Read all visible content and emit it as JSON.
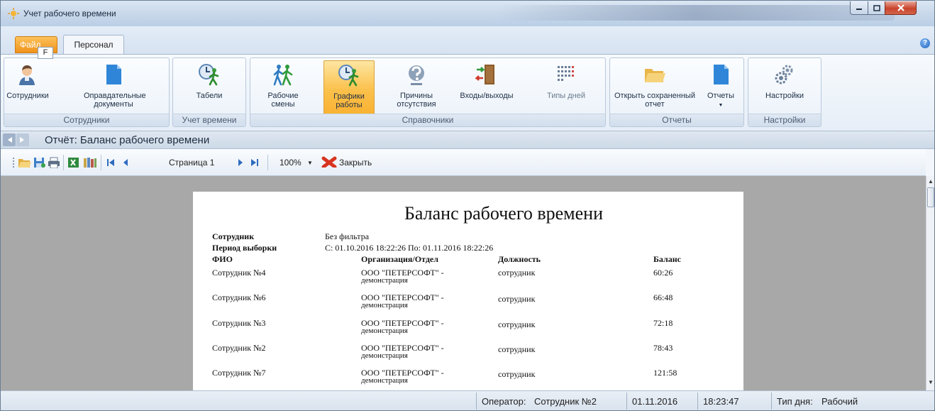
{
  "window": {
    "title": "Учет рабочего времени"
  },
  "tabs": {
    "file": "Файл",
    "file_keytip": "F",
    "personal": "Персонал"
  },
  "ribbon": {
    "groups": [
      {
        "label": "Сотрудники",
        "buttons": [
          {
            "label": "Сотрудники",
            "icon": "employee-icon"
          },
          {
            "label": "Оправдательные документы",
            "icon": "document-icon"
          }
        ]
      },
      {
        "label": "Учет времени",
        "buttons": [
          {
            "label": "Табели",
            "icon": "timesheet-clock-icon"
          }
        ]
      },
      {
        "label": "Справочники",
        "buttons": [
          {
            "label": "Рабочие смены",
            "icon": "shift-people-icon"
          },
          {
            "label": "Графики работы",
            "icon": "schedule-clock-icon",
            "active": true
          },
          {
            "label": "Причины отсутствия",
            "icon": "absence-question-icon"
          },
          {
            "label": "Входы/выходы",
            "icon": "entry-exit-door-icon"
          },
          {
            "label": "Типы дней",
            "icon": "day-types-grid-icon"
          }
        ]
      },
      {
        "label": "Отчеты",
        "buttons": [
          {
            "label": "Открыть сохраненный отчет",
            "icon": "open-folder-icon"
          },
          {
            "label": "Отчеты",
            "icon": "reports-document-icon"
          }
        ]
      },
      {
        "label": "Настройки",
        "buttons": [
          {
            "label": "Настройки",
            "icon": "settings-gears-icon"
          }
        ]
      }
    ]
  },
  "nav": {
    "report_title": "Отчёт: Баланс рабочего времени"
  },
  "toolbar": {
    "page": "Страница 1",
    "zoom": "100%",
    "close": "Закрыть"
  },
  "report": {
    "title": "Баланс рабочего времени",
    "meta": [
      {
        "label": "Сотрудник",
        "value": "Без фильтра"
      },
      {
        "label": "Период выборки",
        "value": "С: 01.10.2016 18:22:26 По: 01.11.2016 18:22:26"
      }
    ],
    "columns": [
      "ФИО",
      "Организация/Отдел",
      "Должность",
      "Баланс"
    ],
    "rows": [
      {
        "name": "Сотрудник №4",
        "org1": "ООО \"ПЕТЕРСОФТ\" -",
        "org2": "демонстрация",
        "position": "сотрудник",
        "balance": "60:26"
      },
      {
        "name": "Сотрудник №6",
        "org1": "ООО \"ПЕТЕРСОФТ\" -",
        "org2": "демонстрация",
        "position": "сотрудник",
        "balance": "66:48"
      },
      {
        "name": "Сотрудник №3",
        "org1": "ООО \"ПЕТЕРСОФТ\" -",
        "org2": "демонстрация",
        "position": "сотрудник",
        "balance": "72:18"
      },
      {
        "name": "Сотрудник №2",
        "org1": "ООО \"ПЕТЕРСОФТ\" -",
        "org2": "демонстрация",
        "position": "сотрудник",
        "balance": "78:43"
      },
      {
        "name": "Сотрудник №7",
        "org1": "ООО \"ПЕТЕРСОФТ\" -",
        "org2": "демонстрация",
        "position": "сотрудник",
        "balance": "121:58"
      }
    ]
  },
  "status": {
    "operator_label": "Оператор:",
    "operator": "Сотрудник №2",
    "date": "01.11.2016",
    "time": "18:23:47",
    "day_type_label": "Тип дня:",
    "day_type": "Рабочий"
  }
}
